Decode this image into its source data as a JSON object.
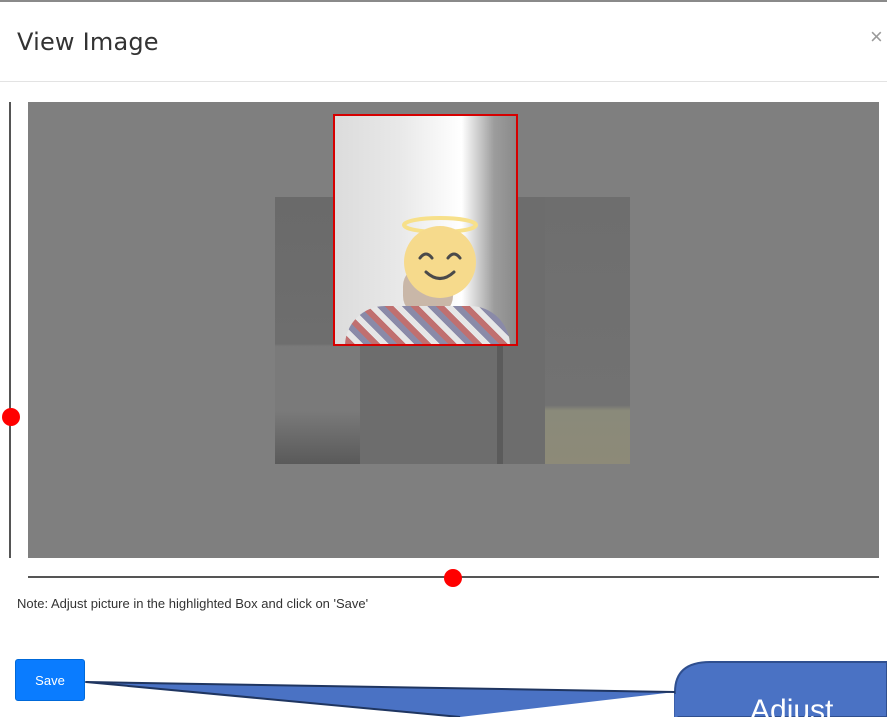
{
  "dialog": {
    "title": "View Image",
    "close_label": "×"
  },
  "image_editor": {
    "note": "Note: Adjust picture in the highlighted Box and click on 'Save'",
    "face_icon": "smiling-face-with-halo-emoji",
    "highlight_color": "#d60000",
    "slider_thumb_color": "#ff0000"
  },
  "actions": {
    "save_label": "Save",
    "save_color": "#0a7cff"
  },
  "callout": {
    "text": "Adjust",
    "fill_color": "#4a72c4"
  }
}
